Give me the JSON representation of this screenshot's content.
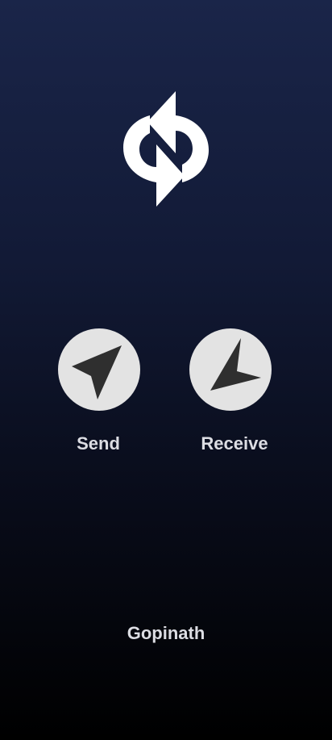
{
  "app": {
    "logo_icon": "sync-arrows-icon"
  },
  "actions": {
    "send": {
      "label": "Send",
      "icon": "send-arrow-icon"
    },
    "receive": {
      "label": "Receive",
      "icon": "receive-arrow-icon"
    }
  },
  "footer": {
    "name": "Gopinath"
  },
  "colors": {
    "background_top": "#1a2549",
    "background_bottom": "#000000",
    "button_fill": "#e3e3e3",
    "icon_dark": "#2f2f2f",
    "text": "#dcdde3"
  }
}
